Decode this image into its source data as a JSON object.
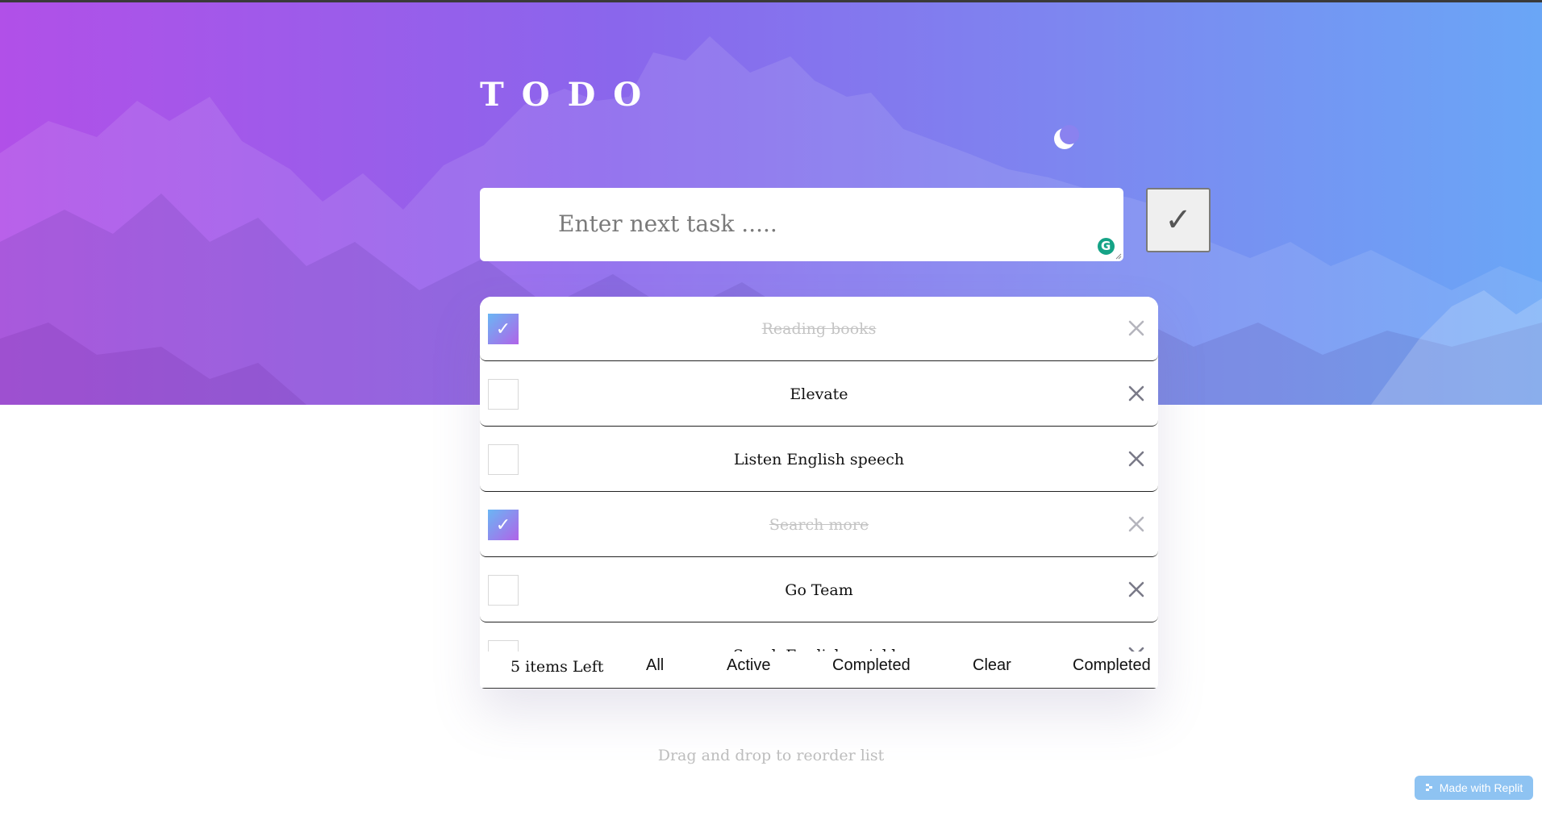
{
  "app": {
    "title": "TODO",
    "theme_toggle_icon": "moon-icon"
  },
  "colors": {
    "hero_gradient_start": "#b150e8",
    "hero_gradient_end": "#6aa6f6",
    "checked_gradient_start": "#6ab6f4",
    "checked_gradient_end": "#b063e8",
    "grammarly": "#15a386"
  },
  "new_task": {
    "placeholder": "Enter next task .....",
    "value": "",
    "submit_label": "✓"
  },
  "todos": [
    {
      "label": "Reading books",
      "completed": true
    },
    {
      "label": "Elevate",
      "completed": false
    },
    {
      "label": "Listen English speech",
      "completed": false
    },
    {
      "label": "Search more",
      "completed": true
    },
    {
      "label": "Go Team",
      "completed": false
    },
    {
      "label": "Speak English quickly",
      "completed": false
    }
  ],
  "footer": {
    "items_left": "5 items Left",
    "filters": [
      "All",
      "Active",
      "Completed"
    ],
    "clear_label": "Clear",
    "clear_completed_label": "Completed"
  },
  "hint": "Drag and drop to reorder list",
  "badge": {
    "label": "Made with Replit"
  }
}
